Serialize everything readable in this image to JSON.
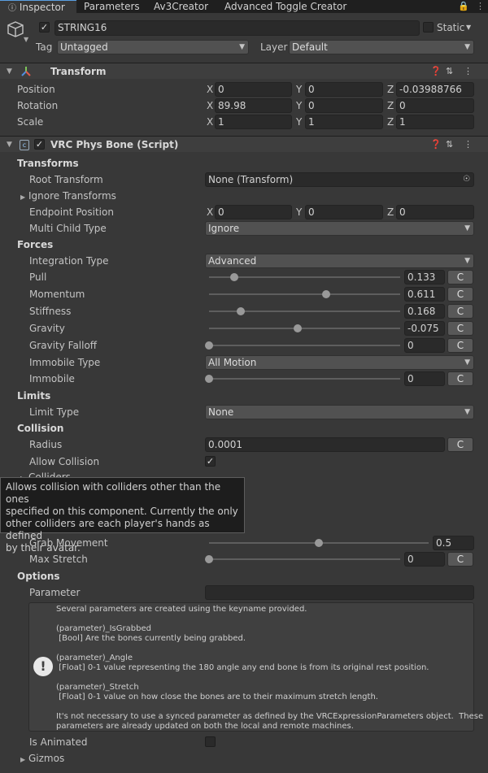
{
  "tabs": [
    {
      "label": "Inspector",
      "icon": "info-icon",
      "active": true
    },
    {
      "label": "Parameters"
    },
    {
      "label": "Av3Creator"
    },
    {
      "label": "Advanced Toggle Creator"
    }
  ],
  "object": {
    "name": "STRING16",
    "static_label": "Static",
    "tag_label": "Tag",
    "tag_value": "Untagged",
    "layer_label": "Layer",
    "layer_value": "Default"
  },
  "transform": {
    "title": "Transform",
    "rows": [
      {
        "label": "Position",
        "x": "0",
        "y": "0",
        "z": "-0.03988766"
      },
      {
        "label": "Rotation",
        "x": "89.98",
        "y": "0",
        "z": "0"
      },
      {
        "label": "Scale",
        "x": "1",
        "y": "1",
        "z": "1"
      }
    ]
  },
  "axes": {
    "x": "X",
    "y": "Y",
    "z": "Z"
  },
  "physbone": {
    "title": "VRC Phys Bone (Script)",
    "transforms_label": "Transforms",
    "root_transform_label": "Root Transform",
    "root_transform_value": "None (Transform)",
    "ignore_transforms_label": "Ignore Transforms",
    "endpoint_label": "Endpoint Position",
    "endpoint": {
      "x": "0",
      "y": "0",
      "z": "0"
    },
    "multi_child_label": "Multi Child Type",
    "multi_child_value": "Ignore",
    "forces_label": "Forces",
    "integration_label": "Integration Type",
    "integration_value": "Advanced",
    "pull": {
      "label": "Pull",
      "value": "0.133",
      "fraction": 0.133
    },
    "momentum": {
      "label": "Momentum",
      "value": "0.611",
      "fraction": 0.611
    },
    "stiffness": {
      "label": "Stiffness",
      "value": "0.168",
      "fraction": 0.168
    },
    "gravity": {
      "label": "Gravity",
      "value": "-0.075",
      "fraction": 0.4625
    },
    "gravity_falloff": {
      "label": "Gravity Falloff",
      "value": "0",
      "fraction": 0
    },
    "immobile_type_label": "Immobile Type",
    "immobile_type_value": "All Motion",
    "immobile": {
      "label": "Immobile",
      "value": "0",
      "fraction": 0
    },
    "limits_label": "Limits",
    "limit_type_label": "Limit Type",
    "limit_type_value": "None",
    "collision_label": "Collision",
    "radius_label": "Radius",
    "radius_value": "0.0001",
    "allow_collision_label": "Allow Collision",
    "colliders_label": "Colliders",
    "grab_movement": {
      "label": "Grab Movement",
      "value": "0.5",
      "fraction": 0.5
    },
    "max_stretch": {
      "label": "Max Stretch",
      "value": "0",
      "fraction": 0
    },
    "options_label": "Options",
    "parameter_label": "Parameter",
    "parameter_value": "",
    "is_animated_label": "Is Animated",
    "gizmos_label": "Gizmos",
    "c_button": "C"
  },
  "tooltip": {
    "lines": [
      "Allows collision with colliders other than the ones",
      "specified on this component.  Currently the only",
      "other colliders are each player's hands as defined",
      "by their avatar."
    ]
  },
  "help": {
    "lines": [
      "Several parameters are created using the keyname provided.",
      "(parameter)_IsGrabbed",
      " [Bool] Are the bones currently being grabbed.",
      "(parameter)_Angle",
      " [Float] 0-1 value representing the 180 angle any end bone is from its original rest position.",
      "(parameter)_Stretch",
      " [Float] 0-1 value on how close the bones are to their maximum stretch length.",
      "It's not necessary to use a synced parameter as defined by the VRCExpressionParameters object.  These",
      "parameters are already updated on both the local and remote machines."
    ]
  }
}
